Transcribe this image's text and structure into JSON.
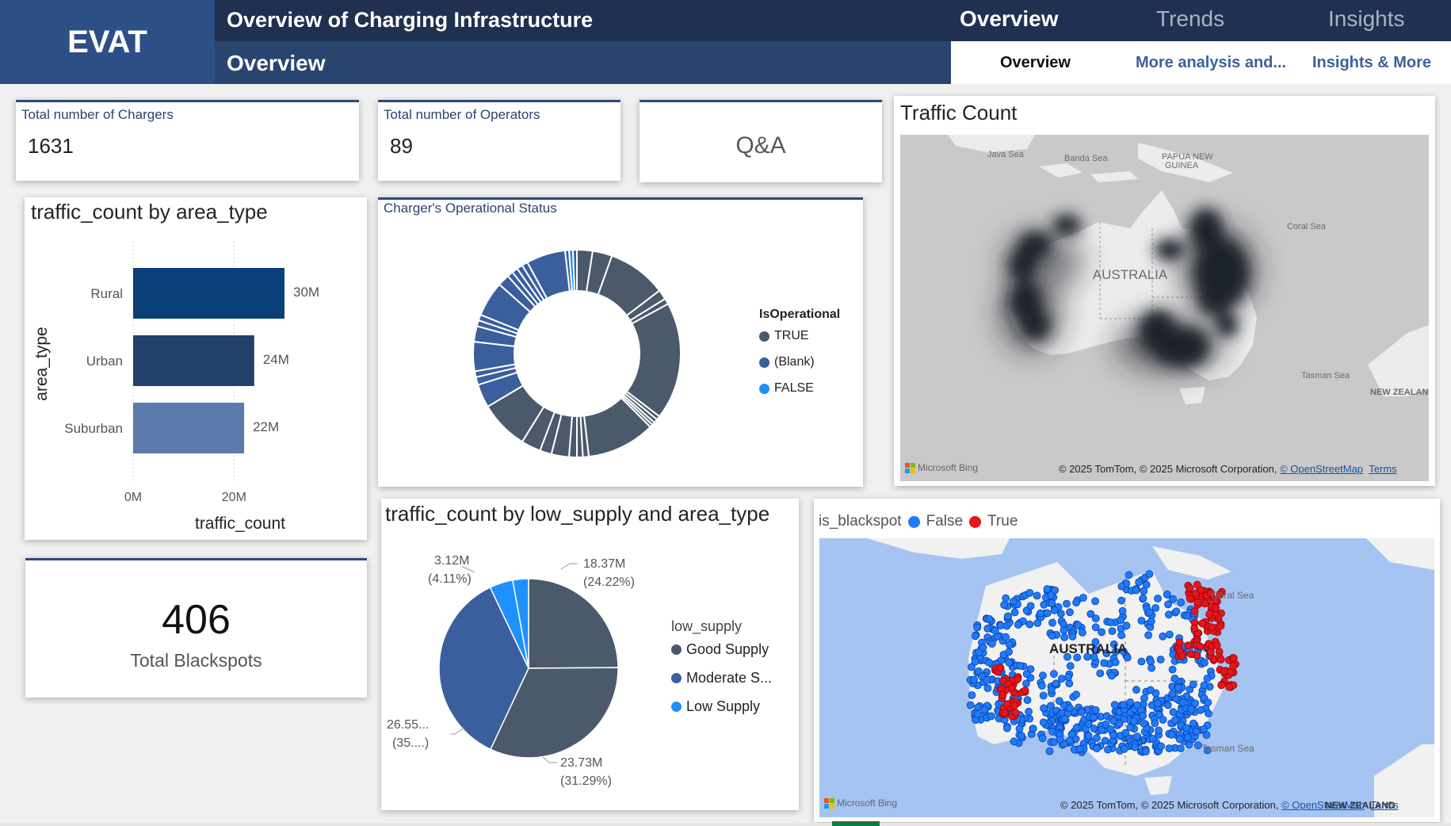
{
  "header": {
    "logo": "EVAT",
    "title": "Overview of Charging Infrastructure",
    "subtitle": "Overview",
    "top_tabs": [
      "Overview",
      "Trends",
      "Insights"
    ],
    "sub_tabs": [
      "Overview",
      "More analysis and...",
      "Insights & More"
    ]
  },
  "kpis": {
    "chargers": {
      "label": "Total number of Chargers",
      "value": "1631"
    },
    "operators": {
      "label": "Total number of Operators",
      "value": "89"
    },
    "qa": {
      "label": "Q&A"
    },
    "blackspots": {
      "value": "406",
      "label": "Total Blackspots"
    }
  },
  "bar_chart": {
    "title": "traffic_count by area_type",
    "xlabel": "traffic_count",
    "ylabel": "area_type",
    "value_labels": [
      "30M",
      "24M",
      "22M"
    ],
    "tick_labels": [
      "0M",
      "20M"
    ]
  },
  "donut_chart": {
    "title": "Charger's Operational Status",
    "legend_title": "IsOperational",
    "legend": [
      {
        "label": "TRUE",
        "color": "#4a5a6b"
      },
      {
        "label": "(Blank)",
        "color": "#3b5f9c"
      },
      {
        "label": "FALSE",
        "color": "#1e90ff"
      }
    ]
  },
  "pie_chart": {
    "title": "traffic_count by low_supply and area_type",
    "legend_title": "low_supply",
    "legend": [
      {
        "label": "Good Supply",
        "color": "#4a5a6b"
      },
      {
        "label": "Moderate S...",
        "color": "#3b5f9c"
      },
      {
        "label": "Low Supply",
        "color": "#1e90ff"
      }
    ],
    "labels": [
      {
        "value": "18.37M",
        "pct": "(24.22%)"
      },
      {
        "value": "23.73M",
        "pct": "(31.29%)"
      },
      {
        "value": "26.55...",
        "pct": "(35....)"
      },
      {
        "value": "3.12M",
        "pct": "(4.11%)"
      }
    ]
  },
  "traffic_map": {
    "title": "Traffic Count",
    "labels": {
      "java": "Java Sea",
      "banda": "Banda Sea",
      "png1": "PAPUA NEW",
      "png2": "GUINEA",
      "coral": "Coral Sea",
      "australia": "AUSTRALIA",
      "tasman": "Tasman Sea",
      "nz": "NEW ZEALAN"
    },
    "bing": "Microsoft Bing",
    "attribution": "© 2025 TomTom, © 2025 Microsoft Corporation,",
    "osm": "© OpenStreetMap",
    "terms": "Terms"
  },
  "blackspot_map": {
    "legend_title": "is_blackspot",
    "legend": [
      {
        "label": "False",
        "color": "#1e7bff"
      },
      {
        "label": "True",
        "color": "#e8151b"
      }
    ],
    "labels": {
      "coral": "Coral Sea",
      "australia": "AUSTRALIA",
      "tasman": "Tasman Sea",
      "nz": "NEW ZEALAND"
    },
    "bing": "Microsoft Bing",
    "attribution": "© 2025 TomTom, © 2025 Microsoft Corporation,",
    "osm": "© OpenStreetMap",
    "terms": "Terms"
  },
  "chart_data": [
    {
      "type": "bar",
      "title": "traffic_count by area_type",
      "categories": [
        "Rural",
        "Urban",
        "Suburban"
      ],
      "values": [
        30000000,
        24000000,
        22000000
      ],
      "colors": [
        "#0b3f78",
        "#233f6b",
        "#5c7bad"
      ],
      "xlabel": "traffic_count",
      "ylabel": "area_type",
      "xlim": [
        0,
        30000000
      ]
    },
    {
      "type": "pie",
      "title": "traffic_count by low_supply and area_type",
      "categories": [
        "Good Supply",
        "Good Supply",
        "Moderate Supply",
        "Low Supply",
        "Low Supply"
      ],
      "values": [
        18.37,
        23.73,
        26.55,
        3.12,
        2.1
      ],
      "colors": [
        "#4a5a6b",
        "#4a5a6b",
        "#3b5f9c",
        "#1e90ff",
        "#1e90ff"
      ]
    }
  ]
}
